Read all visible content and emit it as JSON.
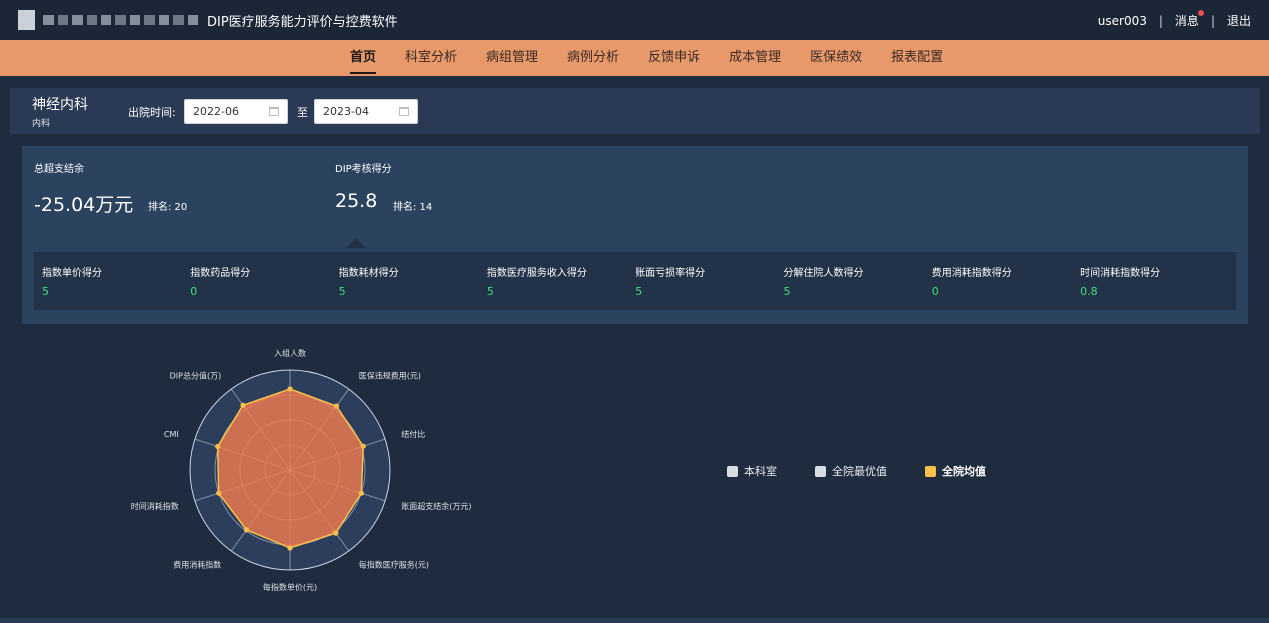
{
  "header": {
    "app_title": "DIP医疗服务能力评价与控费软件",
    "user": "user003",
    "separator": "|",
    "messages_label": "消息",
    "logout_label": "退出"
  },
  "nav": {
    "items": [
      {
        "label": "首页",
        "active": true
      },
      {
        "label": "科室分析",
        "active": false
      },
      {
        "label": "病组管理",
        "active": false
      },
      {
        "label": "病例分析",
        "active": false
      },
      {
        "label": "反馈申诉",
        "active": false
      },
      {
        "label": "成本管理",
        "active": false
      },
      {
        "label": "医保绩效",
        "active": false
      },
      {
        "label": "报表配置",
        "active": false
      }
    ]
  },
  "filter": {
    "dept_name": "神经内科",
    "dept_sub": "内科",
    "date_label": "出院时间:",
    "start_date": "2022-06",
    "to_label": "至",
    "end_date": "2023-04"
  },
  "summary": {
    "balance_label": "总超支结余",
    "balance_value": "-25.04万元",
    "balance_rank": "排名: 20",
    "dip_label": "DIP考核得分",
    "dip_value": "25.8",
    "dip_rank": "排名: 14"
  },
  "scores": [
    {
      "label": "指数单价得分",
      "value": "5"
    },
    {
      "label": "指数药品得分",
      "value": "0"
    },
    {
      "label": "指数耗材得分",
      "value": "5"
    },
    {
      "label": "指数医疗服务收入得分",
      "value": "5"
    },
    {
      "label": "账面亏损率得分",
      "value": "5"
    },
    {
      "label": "分解住院人数得分",
      "value": "5"
    },
    {
      "label": "费用消耗指数得分",
      "value": "0"
    },
    {
      "label": "时间消耗指数得分",
      "value": "0.8"
    }
  ],
  "radar": {
    "axes": [
      "入组人数",
      "医保违规费用(元)",
      "结付比",
      "账面超支结余(万元)",
      "每指数医疗服务(元)",
      "每指数单价(元)",
      "费用消耗指数",
      "时间消耗指数",
      "CMI",
      "DIP总分值(万)"
    ],
    "series_values": [
      0.81,
      0.79,
      0.77,
      0.75,
      0.78,
      0.78,
      0.74,
      0.75,
      0.76,
      0.8
    ],
    "fill_color": "#f07a4f",
    "point_color": "#f8c14a",
    "grid_color": "#c9d4e3",
    "area_color": "#2c3e5b"
  },
  "legend": [
    {
      "label": "本科室",
      "color": "#d8dde3",
      "on": false
    },
    {
      "label": "全院最优值",
      "color": "#d8dde3",
      "on": false
    },
    {
      "label": "全院均值",
      "color": "#f8c14a",
      "on": true
    }
  ]
}
